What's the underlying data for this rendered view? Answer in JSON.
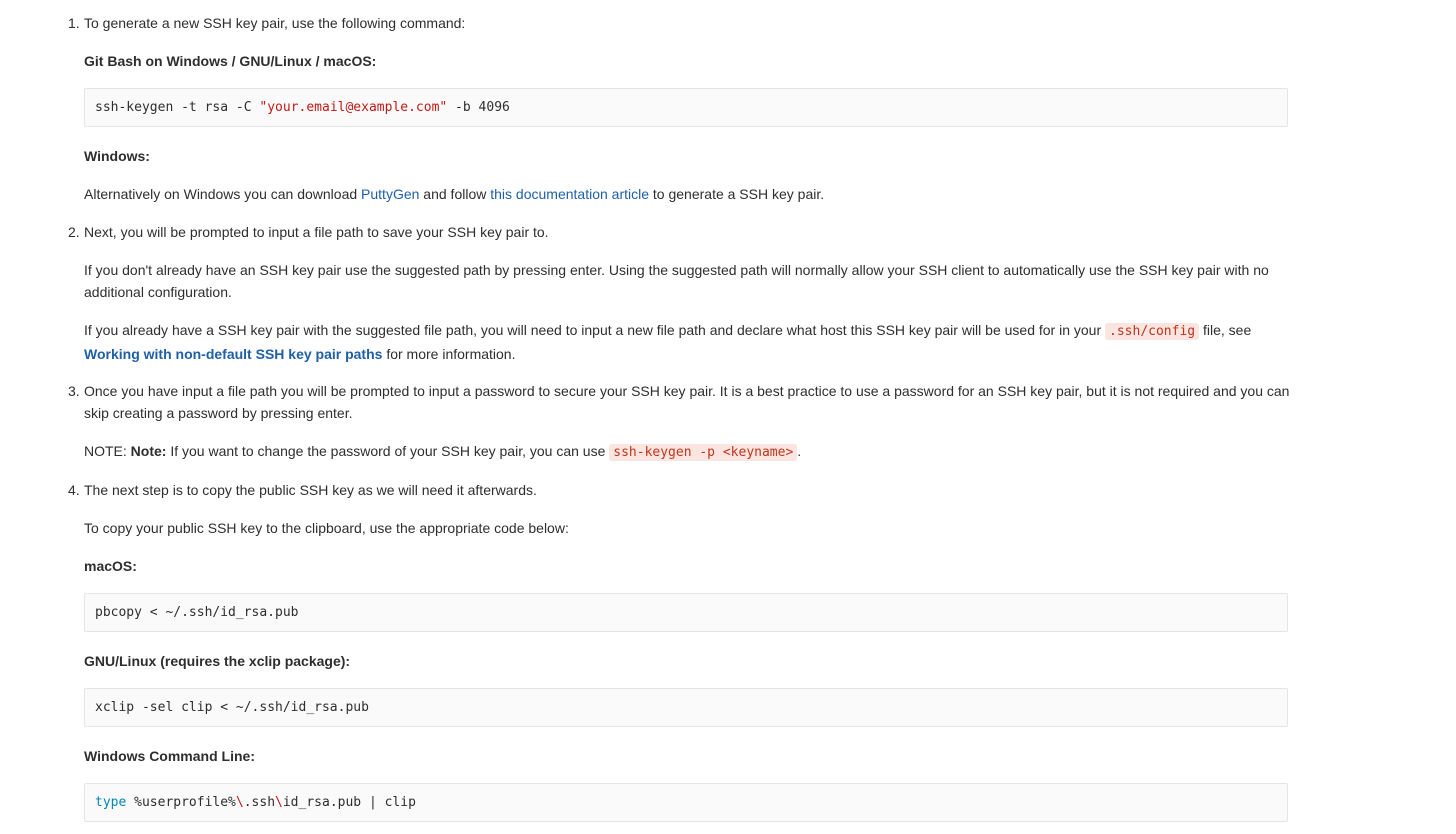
{
  "steps": [
    {
      "num": "1.",
      "intro": "To generate a new SSH key pair, use the following command:",
      "git_heading": "Git Bash on Windows / GNU/Linux / macOS:",
      "code": {
        "cmd": "ssh-keygen",
        "flag_t": " -t",
        "arg_t": " rsa ",
        "flag_c": "-C ",
        "email": "\"your.email@example.com\"",
        "flag_b": " -b",
        "arg_b": " 4096"
      },
      "windows_heading": "Windows:",
      "windows_text_a": "Alternatively on Windows you can download ",
      "puttygen_link": "PuttyGen",
      "windows_text_b": " and follow ",
      "doc_link": "this documentation article",
      "windows_text_c": " to generate a SSH key pair."
    },
    {
      "num": "2.",
      "intro": "Next, you will be prompted to input a file path to save your SSH key pair to.",
      "para1": "If you don't already have an SSH key pair use the suggested path by pressing enter. Using the suggested path will normally allow your SSH client to automatically use the SSH key pair with no additional configuration.",
      "para2_a": "If you already have a SSH key pair with the suggested file path, you will need to input a new file path and declare what host this SSH key pair will be used for in your ",
      "para2_code": ".ssh/config",
      "para2_b": " file, see ",
      "para2_link": "Working with non-default SSH key pair paths",
      "para2_c": " for more information."
    },
    {
      "num": "3.",
      "intro": "Once you have input a file path you will be prompted to input a password to secure your SSH key pair. It is a best practice to use a password for an SSH key pair, but it is not required and you can skip creating a password by pressing enter.",
      "note_prefix": "NOTE: ",
      "note_bold": "Note:",
      "note_text": " If you want to change the password of your SSH key pair, you can use ",
      "note_code": "ssh-keygen -p <keyname>",
      "note_end": "."
    },
    {
      "num": "4.",
      "intro": "The next step is to copy the public SSH key as we will need it afterwards.",
      "para1": "To copy your public SSH key to the clipboard, use the appropriate code below:",
      "mac_heading": "macOS:",
      "mac_code": "pbcopy < ~/.ssh/id_rsa.pub",
      "linux_heading": "GNU/Linux (requires the xclip package):",
      "linux_code_a": "xclip",
      "linux_code_b": " -sel clip < ~/.ssh/id_rsa.pub",
      "win_heading": "Windows Command Line:",
      "win_code_kw": "type",
      "win_code_a": " %userprofile%",
      "win_code_esc1": "\\",
      "win_code_b": ".ssh",
      "win_code_esc2": "\\",
      "win_code_c": "id_rsa.pub | clip"
    }
  ]
}
